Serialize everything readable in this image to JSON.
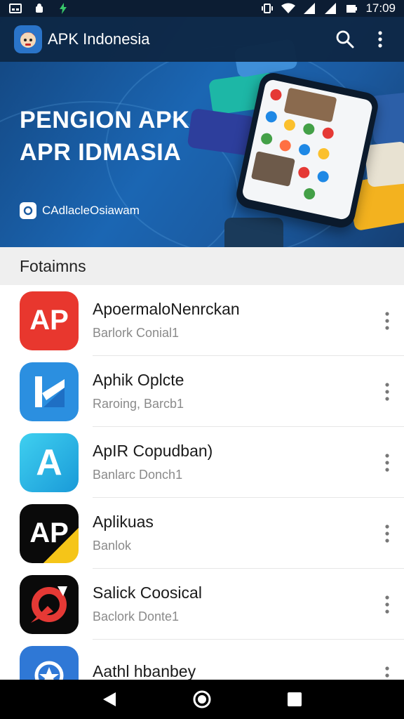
{
  "status_bar": {
    "time": "17:09",
    "icons": [
      "gallery-notification-icon",
      "android-notification-icon",
      "bolt-notification-icon",
      "vibrate-icon",
      "wifi-icon",
      "signal-icon",
      "signal-icon",
      "battery-icon"
    ]
  },
  "app_bar": {
    "title": "APK Indonesia",
    "actions": [
      "search-icon",
      "more-vert-icon"
    ]
  },
  "banner": {
    "title_line1": "PENGION APK",
    "title_line2": "APR IDMASIA",
    "cta_label": "CAdlacleOsiawam"
  },
  "section": {
    "title": "Fotaimns"
  },
  "apps": [
    {
      "name": "ApoermaloNenrckan",
      "subtitle": "Barlork Conial1",
      "icon_text": "AP",
      "icon_bg": "#e8372e"
    },
    {
      "name": "Aphik Oplcte",
      "subtitle": "Raroing, Barcb1",
      "icon_text": "",
      "icon_bg": "#2b8fe0"
    },
    {
      "name": "ApIR Copudban)",
      "subtitle": "Banlarc Donch1",
      "icon_text": "A",
      "icon_bg": "#26b8e8"
    },
    {
      "name": "Aplikuas",
      "subtitle": "Banlok",
      "icon_text": "AP",
      "icon_bg": "#0a0a0a"
    },
    {
      "name": "Salick Coosical",
      "subtitle": "Baclork Donte1",
      "icon_text": "",
      "icon_bg": "#0a0a0a"
    },
    {
      "name": "Aathl hbanbey",
      "subtitle": "",
      "icon_text": "",
      "icon_bg": "#2f78d6"
    }
  ],
  "nav_bar": {
    "buttons": [
      "back-icon",
      "home-icon",
      "recents-icon"
    ]
  },
  "colors": {
    "status_bar": "#0c1d33",
    "app_bar": "#0e2846",
    "banner": "#1b66b3",
    "section_bg": "#efefef"
  }
}
